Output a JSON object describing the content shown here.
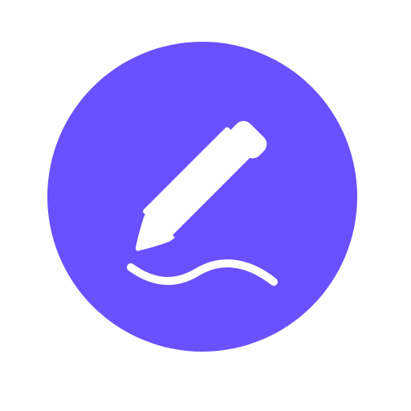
{
  "icon": {
    "name": "pencil-writing-icon",
    "background_color": "#6A50FF",
    "glyph_color": "#FFFFFF",
    "page_background": "#FFFFFF"
  }
}
